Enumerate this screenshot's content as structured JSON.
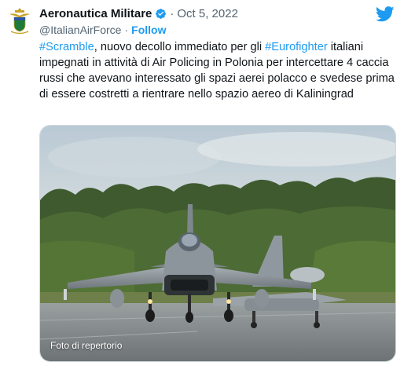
{
  "author": {
    "display_name": "Aeronautica Militare",
    "handle": "@ItalianAirForce",
    "date": "Oct 5, 2022",
    "follow_label": "Follow",
    "separator": "·"
  },
  "tweet": {
    "hashtag1": "#Scramble",
    "text1": ", nuovo decollo immediato per gli ",
    "hashtag2": "#Eurofighter",
    "text2": " italiani impegnati in attività di Air Policing in Polonia per intercettare 4 caccia russi che avevano interessato gli spazi aerei polacco e svedese prima di essere costretti a rientrare nello spazio aereo di Kaliningrad"
  },
  "media": {
    "caption": "Foto di repertorio"
  },
  "colors": {
    "accent": "#1d9bf0",
    "text": "#0f1419",
    "muted": "#536471"
  },
  "icons": {
    "verified": "verified-badge-icon",
    "twitter": "twitter-bird-icon",
    "avatar": "air-force-crest-avatar"
  }
}
